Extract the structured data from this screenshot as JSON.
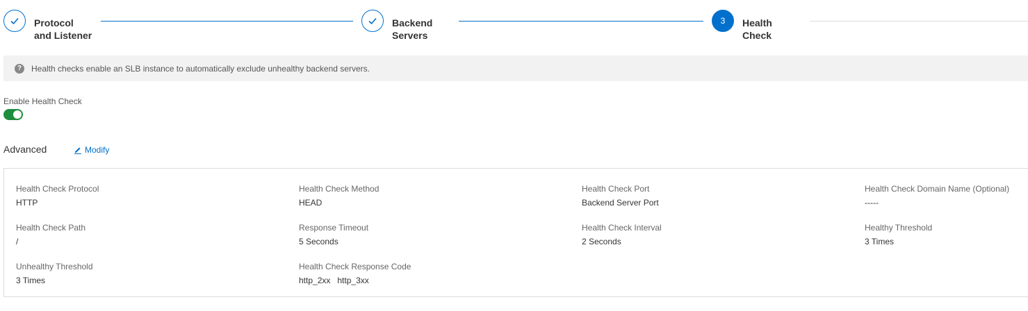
{
  "steps": [
    {
      "line1": "Protocol",
      "line2": "and Listener",
      "state": "done"
    },
    {
      "line1": "Backend",
      "line2": "Servers",
      "state": "done"
    },
    {
      "line1": "Health",
      "line2": "Check",
      "state": "active",
      "number": "3"
    }
  ],
  "info": {
    "icon": "question-icon",
    "text": "Health checks enable an SLB instance to automatically exclude unhealthy backend servers."
  },
  "enable": {
    "label": "Enable Health Check",
    "on": true,
    "color": "#1e8e3e"
  },
  "advanced": {
    "title": "Advanced",
    "modify_label": "Modify"
  },
  "fields": {
    "protocol": {
      "label": "Health Check Protocol",
      "value": "HTTP"
    },
    "method": {
      "label": "Health Check Method",
      "value": "HEAD"
    },
    "port": {
      "label": "Health Check Port",
      "value": "Backend Server Port"
    },
    "domain": {
      "label": "Health Check Domain Name (Optional)",
      "value": "-----"
    },
    "path": {
      "label": "Health Check Path",
      "value": "/"
    },
    "timeout": {
      "label": "Response Timeout",
      "value": "5 Seconds"
    },
    "interval": {
      "label": "Health Check Interval",
      "value": "2 Seconds"
    },
    "healthy": {
      "label": "Healthy Threshold",
      "value": "3 Times"
    },
    "unhealthy": {
      "label": "Unhealthy Threshold",
      "value": "3 Times"
    },
    "codes": {
      "label": "Health Check Response Code",
      "values": [
        "http_2xx",
        "http_3xx"
      ]
    }
  },
  "colors": {
    "accent": "#0070cc"
  }
}
